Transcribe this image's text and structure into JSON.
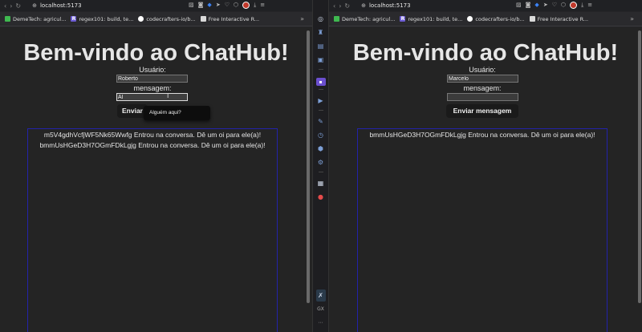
{
  "left": {
    "url": "localhost:5173",
    "bookmarks": [
      "DemeTech: agricul...",
      "regex101: build, te...",
      "codecrafters-io/b...",
      "Free Interactive R..."
    ],
    "title": "Bem-vindo ao ChatHub!",
    "user_label": "Usuário:",
    "user_value": "Roberto",
    "message_label": "mensagem:",
    "message_value": "Al",
    "send_button": "Enviar",
    "tooltip": "Alguém aqui?",
    "messages": [
      "m5V4gdhVcfjWF5Nk65Wwfg Entrou na conversa. Dê um oi para ele(a)!",
      "bmmUsHGeD3H7OGmFDkLgjg Entrou na conversa. Dê um oi para ele(a)!"
    ]
  },
  "right": {
    "url": "localhost:5173",
    "bookmarks": [
      "DemeTech: agricul...",
      "regex101: build, te...",
      "codecrafters-io/b...",
      "Free Interactive R..."
    ],
    "title": "Bem-vindo ao ChatHub!",
    "user_label": "Usuário:",
    "user_value": "Marcelo",
    "message_label": "mensagem:",
    "message_value": "",
    "send_button": "Enviar mensagem",
    "messages": [
      "bmmUsHGeD3H7OGmFDkLgjg Entrou na conversa. Dê um oi para ele(a)!"
    ]
  },
  "sidebar": {
    "badge_text": "GX"
  },
  "colors": {
    "page_bg": "#242424",
    "message_box_border": "#2222aa",
    "button_bg": "#1a1a1a"
  }
}
